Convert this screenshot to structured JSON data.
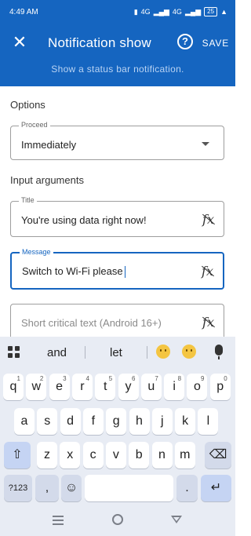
{
  "status_bar": {
    "time": "4:49 AM",
    "indicators": [
      "vibrate-icon",
      "volte-icon",
      "signal-4g-icon",
      "volte-icon",
      "signal-4g-icon"
    ],
    "net_label_1": "4G",
    "net_label_2": "4G",
    "battery": "25"
  },
  "app_bar": {
    "title": "Notification show",
    "save_label": "SAVE",
    "subtitle": "Show a status bar notification.",
    "help_glyph": "?",
    "close_glyph": "✕"
  },
  "form": {
    "options_title": "Options",
    "proceed": {
      "label": "Proceed",
      "value": "Immediately"
    },
    "input_args_title": "Input arguments",
    "title_field": {
      "label": "Title",
      "value": "You're using data right now!"
    },
    "message_field": {
      "label": "Message",
      "value": "Switch to Wi-Fi please"
    },
    "short_text_field": {
      "placeholder": "Short critical text (Android 16+)"
    },
    "fx_glyph": "fx"
  },
  "keyboard": {
    "suggestions": [
      "and",
      "let"
    ],
    "row1": [
      {
        "k": "q",
        "s": "1"
      },
      {
        "k": "w",
        "s": "2"
      },
      {
        "k": "e",
        "s": "3"
      },
      {
        "k": "r",
        "s": "4"
      },
      {
        "k": "t",
        "s": "5"
      },
      {
        "k": "y",
        "s": "6"
      },
      {
        "k": "u",
        "s": "7"
      },
      {
        "k": "i",
        "s": "8"
      },
      {
        "k": "o",
        "s": "9"
      },
      {
        "k": "p",
        "s": "0"
      }
    ],
    "row2": [
      "a",
      "s",
      "d",
      "f",
      "g",
      "h",
      "j",
      "k",
      "l"
    ],
    "row3": [
      "z",
      "x",
      "c",
      "v",
      "b",
      "n",
      "m"
    ],
    "symbols_label": "?123",
    "comma": ",",
    "period": ".",
    "shift_glyph": "⇧",
    "backspace_glyph": "⌫",
    "enter_glyph": "↵",
    "emoji_glyph": "☺"
  }
}
